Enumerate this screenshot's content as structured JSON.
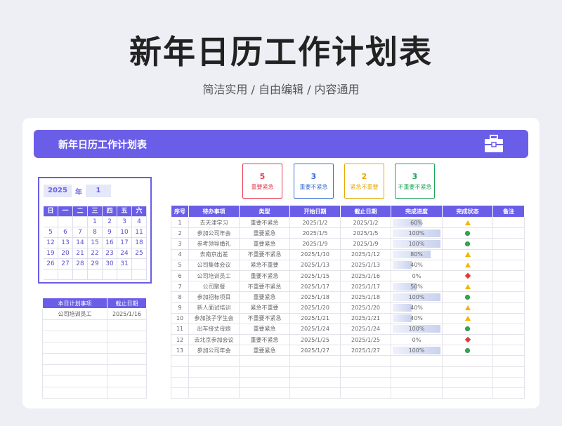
{
  "page": {
    "title": "新年日历工作计划表",
    "subtitle": "简洁实用 / 自由编辑 / 内容通用"
  },
  "banner": {
    "title": "新年日历工作计划表",
    "icon": "toolbox-icon"
  },
  "calendar": {
    "year": "2025",
    "year_label": "年",
    "month": "1",
    "weekdays": [
      "日",
      "一",
      "二",
      "三",
      "四",
      "五",
      "六"
    ],
    "weeks": [
      [
        "",
        "",
        "",
        "1",
        "2",
        "3",
        "4"
      ],
      [
        "5",
        "6",
        "7",
        "8",
        "9",
        "10",
        "11"
      ],
      [
        "12",
        "13",
        "14",
        "15",
        "16",
        "17",
        "18"
      ],
      [
        "19",
        "20",
        "21",
        "22",
        "23",
        "24",
        "25"
      ],
      [
        "26",
        "27",
        "28",
        "29",
        "30",
        "31",
        ""
      ],
      [
        "",
        "",
        "",
        "",
        "",
        "",
        ""
      ]
    ]
  },
  "today_plan": {
    "headers": [
      "本日计划事项",
      "截止日期"
    ],
    "rows": [
      [
        "公司培训员工",
        "2025/1/16"
      ],
      [
        "",
        ""
      ],
      [
        "",
        ""
      ],
      [
        "",
        ""
      ],
      [
        "",
        ""
      ],
      [
        "",
        ""
      ],
      [
        "",
        ""
      ],
      [
        "",
        ""
      ]
    ]
  },
  "summary": [
    {
      "count": "5",
      "label": "重要紧急",
      "color": "#e8384f"
    },
    {
      "count": "3",
      "label": "重要不紧急",
      "color": "#3a6fd8"
    },
    {
      "count": "2",
      "label": "紧急不重要",
      "color": "#e8a800"
    },
    {
      "count": "3",
      "label": "不重要不紧急",
      "color": "#1ea65a"
    }
  ],
  "tasks": {
    "headers": [
      "序号",
      "待办事项",
      "类型",
      "开始日期",
      "截止日期",
      "完成进度",
      "完成状态",
      "备注"
    ],
    "rows": [
      {
        "no": "1",
        "item": "去天津学习",
        "type": "重要不紧急",
        "tc": "t-blue",
        "start": "2025/1/2",
        "end": "2025/1/2",
        "progress": "60%",
        "p": 0.6,
        "status": "warning-triangle-icon"
      },
      {
        "no": "2",
        "item": "参加公司年会",
        "type": "重要紧急",
        "tc": "t-red",
        "start": "2025/1/5",
        "end": "2025/1/5",
        "progress": "100%",
        "p": 1.0,
        "status": "green-circle-icon"
      },
      {
        "no": "3",
        "item": "参考领导婚礼",
        "type": "重要紧急",
        "tc": "t-red",
        "start": "2025/1/9",
        "end": "2025/1/9",
        "progress": "100%",
        "p": 1.0,
        "status": "green-circle-icon"
      },
      {
        "no": "4",
        "item": "去南京出差",
        "type": "不重要不紧急",
        "tc": "t-green",
        "start": "2025/1/10",
        "end": "2025/1/12",
        "progress": "80%",
        "p": 0.8,
        "status": "warning-triangle-icon"
      },
      {
        "no": "5",
        "item": "公司集体会议",
        "type": "紧急不重要",
        "tc": "t-yellow",
        "start": "2025/1/13",
        "end": "2025/1/13",
        "progress": "40%",
        "p": 0.4,
        "status": "warning-triangle-icon"
      },
      {
        "no": "6",
        "item": "公司培训员工",
        "type": "重要不紧急",
        "tc": "t-blue",
        "start": "2025/1/15",
        "end": "2025/1/16",
        "progress": "0%",
        "p": 0.0,
        "status": "red-diamond-icon"
      },
      {
        "no": "7",
        "item": "公司聚餐",
        "type": "不重要不紧急",
        "tc": "t-green",
        "start": "2025/1/17",
        "end": "2025/1/17",
        "progress": "50%",
        "p": 0.5,
        "status": "warning-triangle-icon"
      },
      {
        "no": "8",
        "item": "参加招标项目",
        "type": "重要紧急",
        "tc": "t-red",
        "start": "2025/1/18",
        "end": "2025/1/18",
        "progress": "100%",
        "p": 1.0,
        "status": "green-circle-icon"
      },
      {
        "no": "9",
        "item": "新人面试培训",
        "type": "紧急不重要",
        "tc": "t-yellow",
        "start": "2025/1/20",
        "end": "2025/1/20",
        "progress": "40%",
        "p": 0.4,
        "status": "warning-triangle-icon"
      },
      {
        "no": "10",
        "item": "参加孩子学生会",
        "type": "不重要不紧急",
        "tc": "t-green",
        "start": "2025/1/21",
        "end": "2025/1/21",
        "progress": "40%",
        "p": 0.4,
        "status": "warning-triangle-icon"
      },
      {
        "no": "11",
        "item": "出车接丈母娘",
        "type": "重要紧急",
        "tc": "t-red",
        "start": "2025/1/24",
        "end": "2025/1/24",
        "progress": "100%",
        "p": 1.0,
        "status": "green-circle-icon"
      },
      {
        "no": "12",
        "item": "去北京参加会议",
        "type": "重要不紧急",
        "tc": "t-blue",
        "start": "2025/1/25",
        "end": "2025/1/25",
        "progress": "0%",
        "p": 0.0,
        "status": "red-diamond-icon"
      },
      {
        "no": "13",
        "item": "参加公司年会",
        "type": "重要紧急",
        "tc": "t-red",
        "start": "2025/1/27",
        "end": "2025/1/27",
        "progress": "100%",
        "p": 1.0,
        "status": "green-circle-icon"
      }
    ],
    "empty_rows": 4
  }
}
